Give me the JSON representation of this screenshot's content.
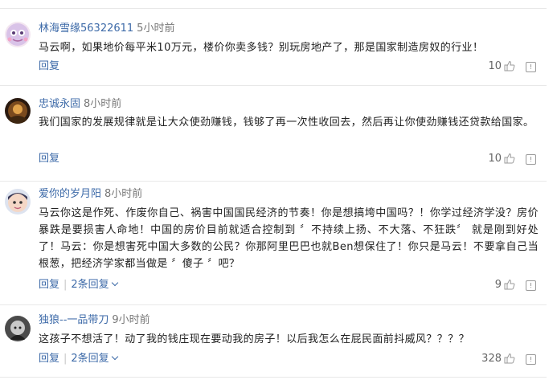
{
  "comments": [
    {
      "user": "林海雪缘56322611",
      "time": "5小时前",
      "text": "马云啊，如果地价每平米10万元，楼价你卖多钱？别玩房地产了，那是国家制造房奴的行业！",
      "reply_label": "回复",
      "likes": "10"
    },
    {
      "user": "忠诚永固",
      "time": "8小时前",
      "text": "我们国家的发展规律就是让大众使劲赚钱，钱够了再一次性收回去，然后再让你使劲赚钱还贷款给国家。",
      "reply_label": "回复",
      "likes": "10"
    },
    {
      "user": "爱你的岁月阳",
      "time": "8小时前",
      "text": "马云你这是作死、作废你自己、祸害中国国民经济的节奏！你是想搞垮中国吗？！你学过经济学没？房价暴跌是要损害人命地！中国的房价目前就适合控制到 〞不持续上扬、不大落、不狂跌〞 就是刚到好处了！马云：你是想害死中国大多数的公民？你那阿里巴巴也就Ben想保住了！你只是马云！不要拿自己当根葱，把经济学家都当做是 〞傻子 〞吧？",
      "reply_label": "回复",
      "replies_label": "2条回复",
      "likes": "9"
    },
    {
      "user": "独狼--一品带刀",
      "time": "9小时前",
      "text": "这孩子不想活了！动了我的钱庄现在要动我的房子！以后我怎么在屁民面前抖威风？？？？",
      "reply_label": "回复",
      "replies_label": "2条回复",
      "likes": "328"
    }
  ],
  "icons": {
    "like": "thumbs-up-icon",
    "report": "report-icon"
  },
  "colors": {
    "username": "#3d6aa8",
    "action": "#3d6aa8",
    "text": "#222222",
    "meta": "#777777"
  }
}
